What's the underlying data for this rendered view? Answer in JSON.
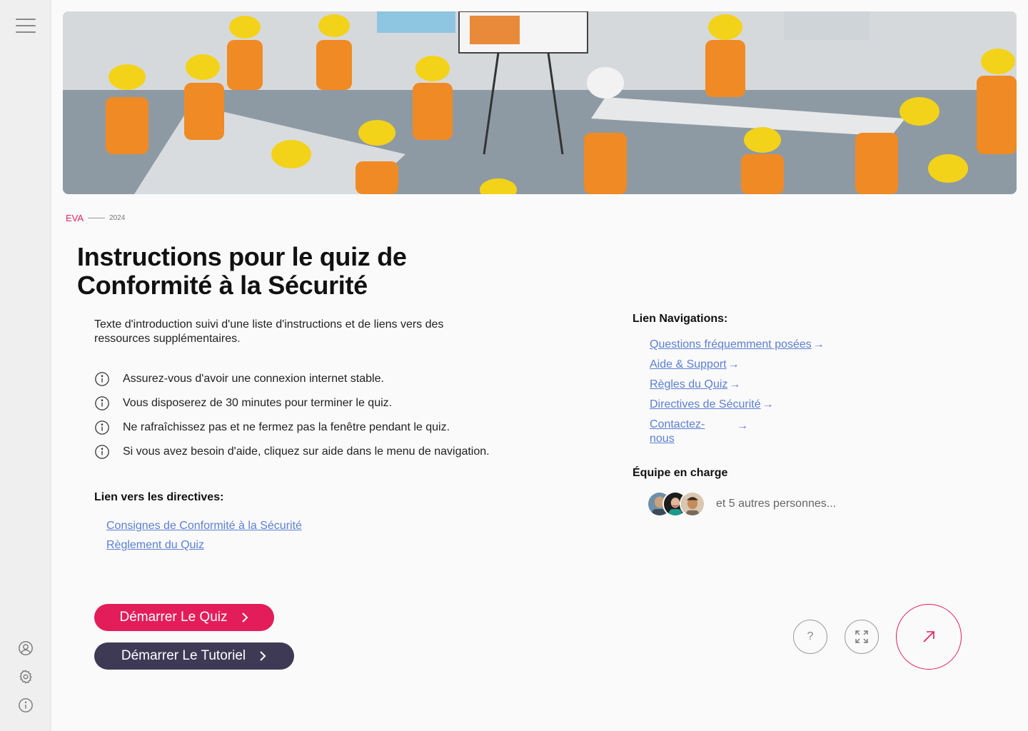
{
  "brand": "EVA",
  "year": "2024",
  "title": "Instructions pour le quiz de Conformité à la Sécurité",
  "intro": "Texte d'introduction suivi d'une liste d'instructions et de liens vers des ressources supplémentaires.",
  "instructions": [
    "Assurez-vous d'avoir une connexion internet stable.",
    "Vous disposerez de 30 minutes pour terminer le quiz.",
    "Ne rafraîchissez pas et ne fermez pas la fenêtre pendant le quiz.",
    "Si vous avez besoin d'aide, cliquez sur aide dans le menu de navigation."
  ],
  "directives": {
    "heading": "Lien vers les directives:",
    "links": [
      "Consignes de Conformité à la Sécurité",
      "Règlement du Quiz"
    ]
  },
  "navigation": {
    "heading": "Lien Navigations:",
    "arrow": "→",
    "links": [
      "Questions fréquemment posées",
      "Aide & Support",
      "Règles du Quiz",
      "Directives de Sécurité",
      "Contactez-nous"
    ]
  },
  "team": {
    "heading": "Équipe en charge",
    "more": "et 5 autres personnes..."
  },
  "buttons": {
    "start_quiz": "Démarrer Le Quiz",
    "start_tutorial": "Démarrer Le Tutoriel",
    "help": "?"
  },
  "icons": {
    "menu": "menu-icon",
    "user": "user-icon",
    "settings": "gear-icon",
    "info": "info-icon",
    "fullscreen": "fullscreen-icon",
    "go": "arrow-up-right-icon"
  },
  "colors": {
    "accent": "#e31c5a",
    "dark": "#3e3a56",
    "link": "#5b7fd4"
  }
}
